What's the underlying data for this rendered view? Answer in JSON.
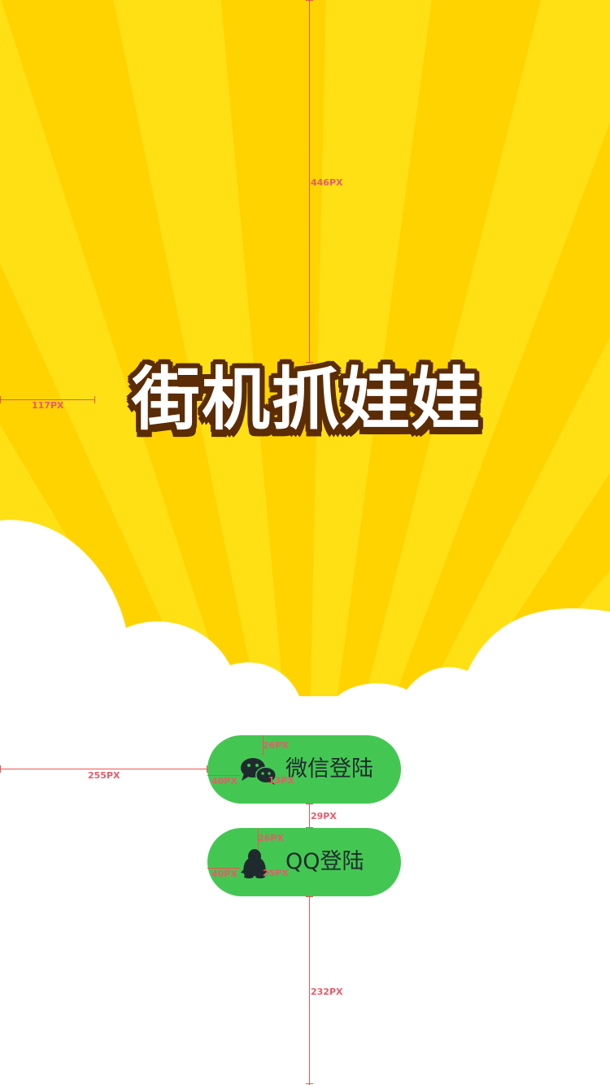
{
  "title": "街机抓娃娃",
  "buttons": {
    "wechat": {
      "label": "微信登陆",
      "icon": "wechat-icon"
    },
    "qq": {
      "label": "QQ登陆",
      "icon": "qq-penguin-icon"
    }
  },
  "spec_labels": {
    "title_top": "446PX",
    "title_left": "117PX",
    "button_left": "255PX",
    "wechat_icon_top": "26PX",
    "wechat_icon_left": "40PX",
    "wechat_icon_gap": "13PX",
    "button_gap": "29PX",
    "qq_icon_top": "26PX",
    "qq_icon_left": "40PX",
    "qq_icon_gap": "25PX",
    "bottom": "232PX"
  },
  "colors": {
    "sunburst_base": "#ffd300",
    "sunburst_ray": "#ffe015",
    "title_outline": "#5b2c06",
    "button_green": "#44c752",
    "cloud": "#ffffff",
    "spec_red": "#ef5350"
  }
}
